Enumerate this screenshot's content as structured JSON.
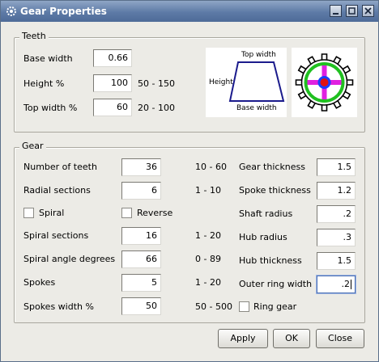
{
  "window": {
    "title": "Gear Properties"
  },
  "teeth": {
    "group_title": "Teeth",
    "base_width": {
      "label": "Base width",
      "value": "0.66"
    },
    "height_pct": {
      "label": "Height %",
      "value": "100",
      "range": "50 - 150"
    },
    "top_width_pct": {
      "label": "Top width %",
      "value": "60",
      "range": "20 - 100"
    },
    "diagram": {
      "top": "Top width",
      "side": "Height",
      "base": "Base width"
    }
  },
  "gear": {
    "group_title": "Gear",
    "left": [
      {
        "label": "Number of teeth",
        "value": "36",
        "range": "10 - 60"
      },
      {
        "label": "Radial sections",
        "value": "6",
        "range": "1 - 10"
      },
      {
        "label": "Spiral sections",
        "value": "16",
        "range": "1 - 20"
      },
      {
        "label": "Spiral angle degrees",
        "value": "66",
        "range": "0 - 89"
      },
      {
        "label": "Spokes",
        "value": "5",
        "range": "1 - 20"
      },
      {
        "label": "Spokes width %",
        "value": "50",
        "range": "50 - 500"
      }
    ],
    "spiral": {
      "label": "Spiral",
      "checked": false
    },
    "reverse": {
      "label": "Reverse",
      "checked": false
    },
    "right": [
      {
        "label": "Gear thickness",
        "value": "1.5"
      },
      {
        "label": "Spoke thickness",
        "value": "1.2"
      },
      {
        "label": "Shaft radius",
        "value": ".2"
      },
      {
        "label": "Hub radius",
        "value": ".3"
      },
      {
        "label": "Hub thickness",
        "value": "1.5"
      },
      {
        "label": "Outer ring width",
        "value": ".2"
      }
    ],
    "ring_gear": {
      "label": "Ring gear",
      "checked": false
    }
  },
  "buttons": {
    "apply": "Apply",
    "ok": "OK",
    "close": "Close"
  },
  "icons": [
    "app-gear-icon",
    "minimize-icon",
    "maximize-icon",
    "close-icon"
  ]
}
